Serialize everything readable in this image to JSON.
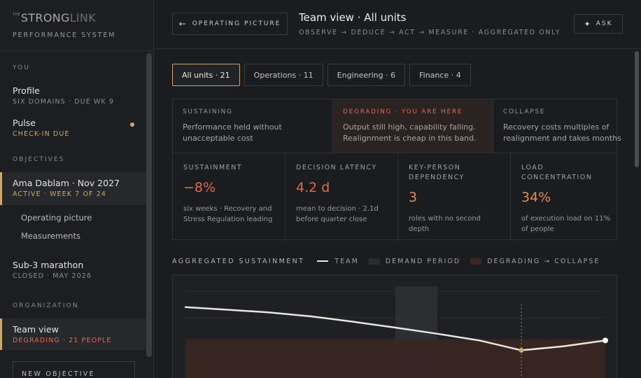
{
  "brand": {
    "the": "THE",
    "strong": "STRONG",
    "link": "LINK",
    "subtitle": "PERFORMANCE SYSTEM"
  },
  "sidebar": {
    "you_title": "YOU",
    "profile": {
      "title": "Profile",
      "sub": "SIX DOMAINS · DUE WK 9"
    },
    "pulse": {
      "title": "Pulse",
      "sub": "CHECK-IN DUE"
    },
    "objectives_title": "OBJECTIVES",
    "ama": {
      "title": "Ama Dablam · Nov 2027",
      "sub": "ACTIVE · WEEK 7 OF 24"
    },
    "ama_links": [
      "Operating picture",
      "Measurements"
    ],
    "marathon": {
      "title": "Sub-3 marathon",
      "sub": "CLOSED · MAY 2026"
    },
    "org_title": "ORGANIZATION",
    "team": {
      "title": "Team view",
      "sub": "DEGRADING · 21 PEOPLE"
    },
    "new_objective": "NEW OBJECTIVE"
  },
  "header": {
    "back_label": "OPERATING PICTURE",
    "title": "Team view · All units",
    "subtitle": "OBSERVE → DEDUCE → ACT → MEASURE · AGGREGATED ONLY",
    "ask_label": "ASK"
  },
  "tabs": [
    "All units · 21",
    "Operations · 11",
    "Engineering · 6",
    "Finance · 4"
  ],
  "zones": [
    {
      "label": "SUSTAINING",
      "desc": "Performance held without unacceptable cost"
    },
    {
      "label": "DEGRADING · YOU ARE HERE",
      "desc": "Output still high, capability falling. Realignment is cheap in this band."
    },
    {
      "label": "COLLAPSE",
      "desc": "Recovery costs multiples of realignment and takes months"
    }
  ],
  "metrics": [
    {
      "label": "SUSTAINMENT",
      "value": "−8%",
      "desc": "six weeks · Recovery and Stress Regulation leading"
    },
    {
      "label": "DECISION LATENCY",
      "value": "4.2 d",
      "desc": "mean to decision · 2.1d before quarter close"
    },
    {
      "label": "KEY-PERSON DEPENDENCY",
      "value": "3",
      "desc": "roles with no second depth"
    },
    {
      "label": "LOAD CONCENTRATION",
      "value": "34%",
      "desc": "of execution load on 11% of people"
    }
  ],
  "chart_header": {
    "title": "AGGREGATED SUSTAINMENT",
    "legend": [
      "TEAM",
      "DEMAND PERIOD",
      "DEGRADING → COLLAPSE"
    ]
  },
  "colors": {
    "accent": "#c9a876",
    "danger": "#dd6b4f",
    "demand_band": "#2f3135",
    "collapse_band": "#3a2622",
    "team_line": "#e8e6e1"
  },
  "chart_data": {
    "type": "line",
    "title": "AGGREGATED SUSTAINMENT",
    "series": [
      {
        "name": "TEAM",
        "values": [
          100,
          99,
          98,
          96.5,
          94.5,
          92.3,
          90,
          87.5,
          83.8,
          85.3,
          87.5
        ]
      }
    ],
    "x": [
      0,
      1,
      2,
      3,
      4,
      5,
      6,
      7,
      8,
      9,
      10
    ],
    "bands": [
      {
        "name": "DEMAND PERIOD",
        "axis": "x",
        "range": [
          5,
          6
        ]
      },
      {
        "name": "DEGRADING → COLLAPSE",
        "axis": "y",
        "range": [
          70,
          88
        ]
      }
    ],
    "marker_x": 8,
    "ylim": [
      70,
      112
    ],
    "xlim": [
      0,
      10
    ],
    "grid": true,
    "legend": "top"
  }
}
